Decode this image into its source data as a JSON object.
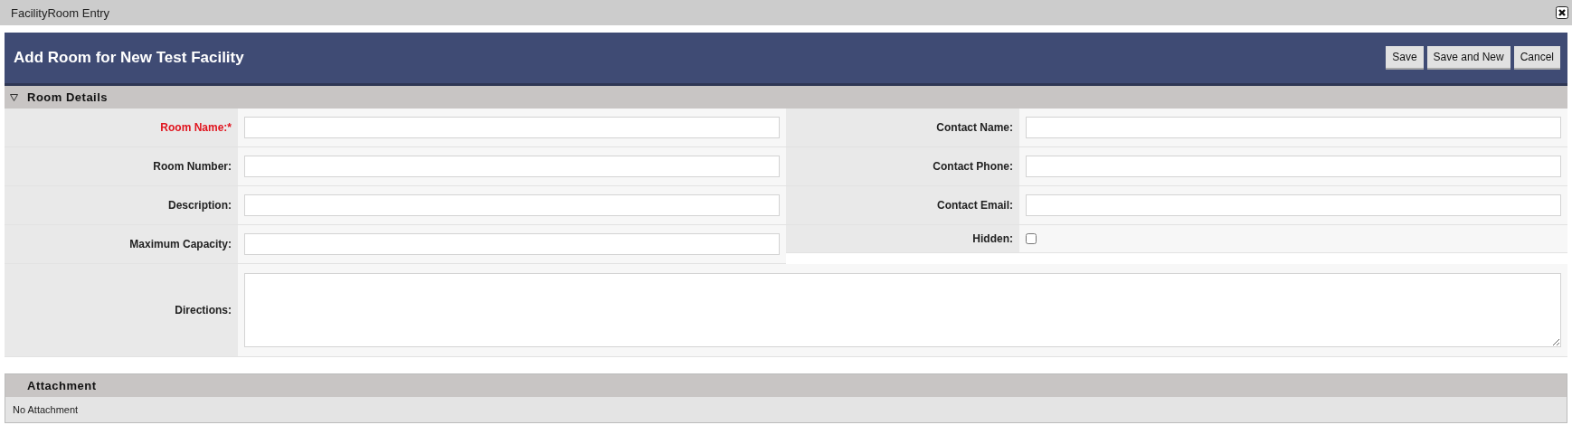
{
  "window": {
    "title": "FacilityRoom Entry"
  },
  "header": {
    "title": "Add Room for New Test Facility",
    "buttons": [
      "Save",
      "Save and New",
      "Cancel"
    ]
  },
  "room_details": {
    "title": "Room Details",
    "expanded": true,
    "left_fields": [
      {
        "label": "Room Name:*",
        "kind": "text",
        "required": true
      },
      {
        "label": "Room Number:",
        "kind": "text",
        "required": false
      },
      {
        "label": "Description:",
        "kind": "text",
        "required": false
      },
      {
        "label": "Maximum Capacity:",
        "kind": "text",
        "required": false
      }
    ],
    "right_fields": [
      {
        "label": "Contact Name:",
        "kind": "text",
        "required": false
      },
      {
        "label": "Contact Phone:",
        "kind": "text",
        "required": false
      },
      {
        "label": "Contact Email:",
        "kind": "text",
        "required": false
      },
      {
        "label": "Hidden:",
        "kind": "checkbox",
        "required": false,
        "checked": false
      }
    ],
    "directions": {
      "label": "Directions:",
      "kind": "textarea",
      "required": false
    }
  },
  "attachment": {
    "title": "Attachment",
    "message": "No Attachment"
  }
}
